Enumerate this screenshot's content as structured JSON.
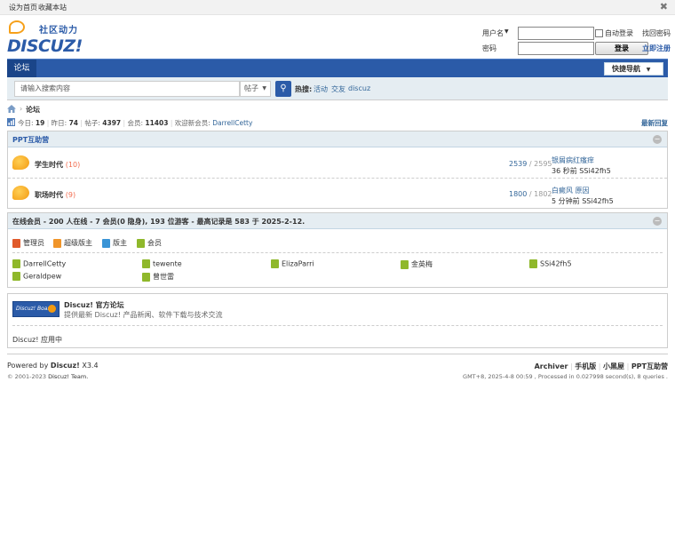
{
  "topbar": {
    "set_home": "设为首页",
    "bookmark": "收藏本站"
  },
  "header": {
    "slogan": "社区动力",
    "logo_text": "DISCUZ!",
    "username_label": "用户名",
    "password_label": "密码",
    "auto_login": "自动登录",
    "find_password": "找回密码",
    "login_button": "登录",
    "register": "立即注册"
  },
  "nav": {
    "forum_tab": "论坛",
    "quick_nav": "快捷导航"
  },
  "search": {
    "placeholder": "请输入搜索内容",
    "type": "帖子",
    "hot_label": "热搜:",
    "hot": [
      "活动",
      "交友",
      "discuz"
    ]
  },
  "breadcrumb": {
    "current": "论坛"
  },
  "stats": {
    "today_label": "今日:",
    "today": "19",
    "yesterday_label": "昨日:",
    "yesterday": "74",
    "posts_label": "帖子:",
    "posts": "4397",
    "members_label": "会员:",
    "members": "11403",
    "welcome": "欢迎新会员:",
    "newest": "DarrellCetty",
    "latest_reply": "最新回复"
  },
  "category": {
    "title": "PPT互助营",
    "forums": [
      {
        "name": "学生时代",
        "new": "(10)",
        "threads": "2539",
        "posts": "2595",
        "last_title": "银屑病红瘙痒",
        "last_time": "36 秒前",
        "last_user": "SSi42fh5"
      },
      {
        "name": "职场时代",
        "new": "(9)",
        "threads": "1800",
        "posts": "1802",
        "last_title": "白癜风 原因",
        "last_time": "5 分钟前",
        "last_user": "SSi42fh5"
      }
    ]
  },
  "online": {
    "title": "在线会员 - 200 人在线 - 7 会员(0 隐身), 193 位游客 - 最高记录是 583 于 2025-2-12.",
    "legend": [
      "管理员",
      "超级版主",
      "版主",
      "会员"
    ],
    "users": [
      "DarrellCetty",
      "tewente",
      "ElizaParri",
      "金英梅",
      "SSi42fh5",
      "Geraldpew",
      "曾世雷"
    ]
  },
  "links": {
    "official_name": "Discuz! 官方论坛",
    "official_desc": "提供最新 Discuz! 产品新闻、软件下载与技术交流",
    "badge_text": "Discuz! Board",
    "app_center": "Discuz! 应用中"
  },
  "footer": {
    "powered": "Powered by",
    "product": "Discuz!",
    "version": "X3.4",
    "copyright": "© 2001-2023",
    "team": "Discuz! Team.",
    "archiver": "Archiver",
    "mobile": "手机版",
    "blackroom": "小黑屋",
    "site": "PPT互助营",
    "process": "GMT+8, 2025-4-8 00:59 , Processed in 0.027998 second(s), 8 queries ."
  },
  "colors": {
    "brand_blue": "#2b5ba8",
    "header_bg": "#e5edf2",
    "orange": "#f39a10"
  }
}
